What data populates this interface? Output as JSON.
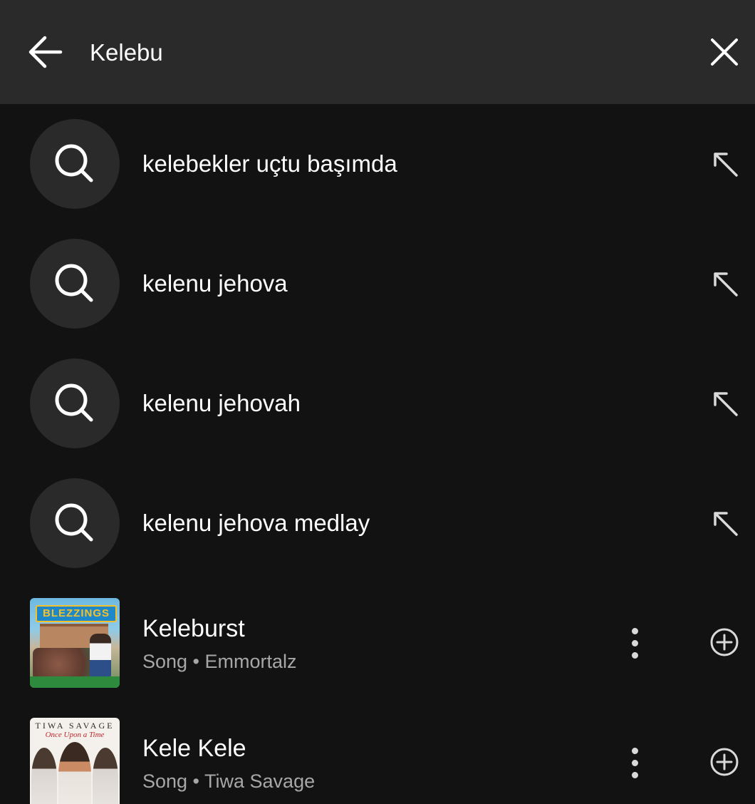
{
  "search": {
    "query": "Kelebu",
    "back_icon": "arrow-left-icon",
    "clear_icon": "close-icon"
  },
  "suggestions": [
    {
      "label": "kelebekler uçtu başımda",
      "icon": "search-icon",
      "fill_icon": "arrow-up-left-icon"
    },
    {
      "label": "kelenu jehova",
      "icon": "search-icon",
      "fill_icon": "arrow-up-left-icon"
    },
    {
      "label": "kelenu jehovah",
      "icon": "search-icon",
      "fill_icon": "arrow-up-left-icon"
    },
    {
      "label": "kelenu jehova medlay",
      "icon": "search-icon",
      "fill_icon": "arrow-up-left-icon"
    }
  ],
  "results": [
    {
      "title": "Keleburst",
      "subtitle": "Song • Emmortalz",
      "artwork_text": "BLEZZINGS",
      "more_icon": "more-vertical-icon",
      "add_icon": "add-circle-icon"
    },
    {
      "title": "Kele Kele",
      "subtitle": "Song • Tiwa Savage",
      "artwork_text": "TIWA SAVAGE",
      "artwork_subtext": "Once Upon a Time",
      "more_icon": "more-vertical-icon",
      "add_icon": "add-circle-icon"
    }
  ],
  "colors": {
    "background": "#121212",
    "header": "#2a2a2a",
    "icon_circle": "#2a2a2a",
    "primary_text": "#ffffff",
    "secondary_text": "#a7a7a7"
  }
}
